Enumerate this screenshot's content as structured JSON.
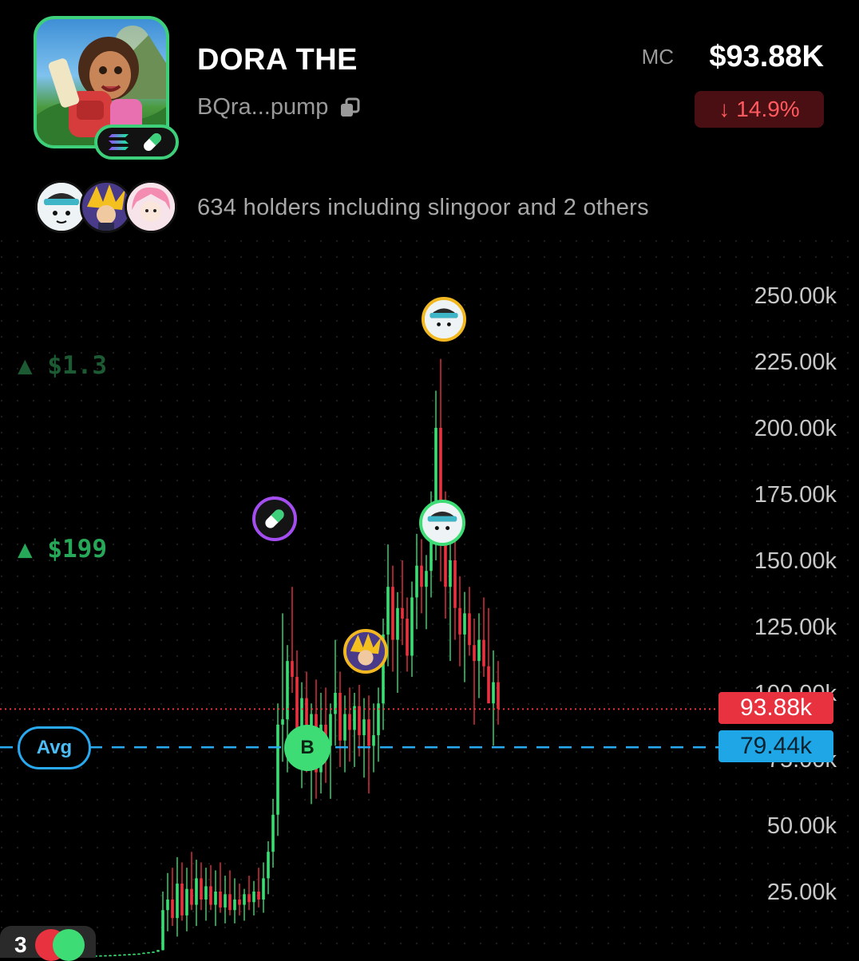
{
  "token": {
    "name": "DORA THE",
    "address": "BQra...pump",
    "market_cap_label": "MC",
    "market_cap_value": "$93.88K",
    "change": "14.9%",
    "chain_icon": "solana-icon",
    "platform_icon": "pill-icon"
  },
  "holders": {
    "text": "634 holders including slingoor and 2 others"
  },
  "chart_data": {
    "type": "candlestick",
    "ylabels": [
      "250.00k",
      "225.00k",
      "200.00k",
      "175.00k",
      "150.00k",
      "125.00k",
      "100.00k",
      "75.00k",
      "50.00k",
      "25.00k"
    ],
    "current_price_label": "93.88k",
    "current_price_value": 93880,
    "avg_price_label": "79.44k",
    "avg_price_value": 79440,
    "avg_label": "Avg",
    "buy_marker_label": "B",
    "left_tags": [
      "$1.3",
      "$199"
    ],
    "corner_count": "3",
    "colors": {
      "up": "#3ddc74",
      "down": "#e8323f",
      "avg": "#29a9f0",
      "current": "#e8323f"
    },
    "candles": [
      [
        0.8,
        0.9,
        0.7,
        0.85
      ],
      [
        0.85,
        0.95,
        0.8,
        0.9
      ],
      [
        0.9,
        1.0,
        0.85,
        0.95
      ],
      [
        0.95,
        1.1,
        0.9,
        1.0
      ],
      [
        1.0,
        1.2,
        0.95,
        1.1
      ],
      [
        1.1,
        1.3,
        1.0,
        1.2
      ],
      [
        1.2,
        1.4,
        1.1,
        1.3
      ],
      [
        1.3,
        1.5,
        1.2,
        1.4
      ],
      [
        1.4,
        1.6,
        1.3,
        1.5
      ],
      [
        1.5,
        1.7,
        1.4,
        1.6
      ],
      [
        1.6,
        2.0,
        1.5,
        1.9
      ],
      [
        1.9,
        2.2,
        1.8,
        2.1
      ],
      [
        2.1,
        2.4,
        2.0,
        2.3
      ],
      [
        2.3,
        3.0,
        2.2,
        2.9
      ],
      [
        2.9,
        25,
        2.8,
        18
      ],
      [
        18,
        32,
        10,
        22
      ],
      [
        22,
        34,
        12,
        15
      ],
      [
        15,
        38,
        8,
        28
      ],
      [
        28,
        36,
        14,
        16
      ],
      [
        16,
        34,
        10,
        26
      ],
      [
        26,
        40,
        18,
        20
      ],
      [
        20,
        37,
        12,
        30
      ],
      [
        30,
        36,
        18,
        22
      ],
      [
        22,
        34,
        14,
        27
      ],
      [
        27,
        35,
        18,
        20
      ],
      [
        20,
        33,
        12,
        25
      ],
      [
        25,
        36,
        17,
        19
      ],
      [
        19,
        31,
        13,
        24
      ],
      [
        24,
        33,
        16,
        18
      ],
      [
        18,
        30,
        13,
        22
      ],
      [
        22,
        28,
        16,
        20
      ],
      [
        20,
        26,
        14,
        24
      ],
      [
        24,
        31,
        18,
        21
      ],
      [
        21,
        29,
        16,
        25
      ],
      [
        25,
        34,
        19,
        22
      ],
      [
        22,
        36,
        17,
        30
      ],
      [
        30,
        44,
        24,
        40
      ],
      [
        40,
        60,
        34,
        54
      ],
      [
        54,
        96,
        46,
        88
      ],
      [
        88,
        130,
        74,
        90
      ],
      [
        90,
        118,
        70,
        112
      ],
      [
        112,
        140,
        100,
        106
      ],
      [
        106,
        116,
        76,
        86
      ],
      [
        86,
        104,
        64,
        98
      ],
      [
        98,
        108,
        70,
        78
      ],
      [
        78,
        96,
        58,
        92
      ],
      [
        92,
        105,
        60,
        70
      ],
      [
        70,
        100,
        62,
        88
      ],
      [
        88,
        102,
        66,
        80
      ],
      [
        80,
        96,
        60,
        92
      ],
      [
        92,
        120,
        80,
        100
      ],
      [
        100,
        108,
        72,
        82
      ],
      [
        82,
        99,
        70,
        92
      ],
      [
        92,
        102,
        74,
        86
      ],
      [
        86,
        100,
        72,
        95
      ],
      [
        95,
        103,
        76,
        84
      ],
      [
        84,
        98,
        68,
        90
      ],
      [
        90,
        99,
        62,
        80
      ],
      [
        80,
        96,
        70,
        84
      ],
      [
        84,
        102,
        74,
        96
      ],
      [
        96,
        128,
        86,
        122
      ],
      [
        122,
        156,
        110,
        140
      ],
      [
        140,
        148,
        108,
        120
      ],
      [
        120,
        138,
        100,
        132
      ],
      [
        132,
        150,
        118,
        128
      ],
      [
        128,
        136,
        108,
        114
      ],
      [
        114,
        142,
        106,
        136
      ],
      [
        136,
        160,
        124,
        148
      ],
      [
        148,
        158,
        130,
        140
      ],
      [
        140,
        152,
        124,
        146
      ],
      [
        146,
        176,
        136,
        164
      ],
      [
        164,
        214,
        150,
        200
      ],
      [
        200,
        226,
        142,
        166
      ],
      [
        166,
        176,
        128,
        140
      ],
      [
        140,
        160,
        112,
        150
      ],
      [
        150,
        170,
        120,
        132
      ],
      [
        132,
        144,
        110,
        122
      ],
      [
        122,
        138,
        104,
        130
      ],
      [
        130,
        140,
        114,
        118
      ],
      [
        118,
        128,
        88,
        112
      ],
      [
        112,
        130,
        98,
        120
      ],
      [
        120,
        136,
        106,
        110
      ],
      [
        110,
        132,
        98,
        96
      ],
      [
        96,
        116,
        80,
        104
      ],
      [
        104,
        112,
        88,
        94
      ]
    ]
  }
}
